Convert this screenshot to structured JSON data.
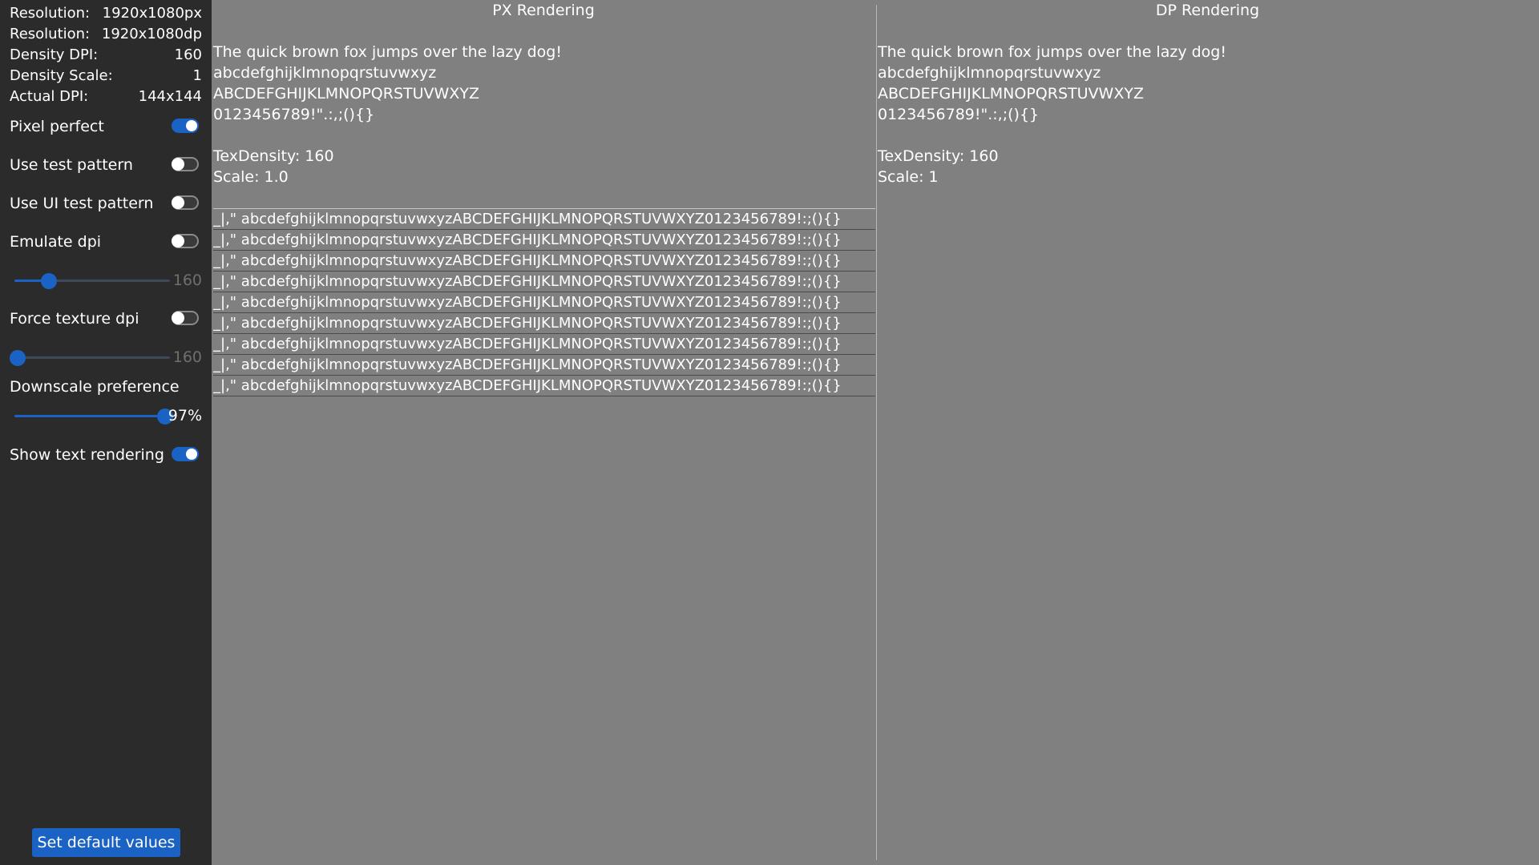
{
  "sidebar": {
    "info": [
      {
        "label": "Resolution:",
        "value": "1920x1080px"
      },
      {
        "label": "Resolution:",
        "value": "1920x1080dp"
      },
      {
        "label": "Density DPI:",
        "value": "160"
      },
      {
        "label": "Density Scale:",
        "value": "1"
      },
      {
        "label": "Actual DPI:",
        "value": "144x144"
      }
    ],
    "toggles": {
      "pixel_perfect": {
        "label": "Pixel perfect",
        "on": true
      },
      "use_test_pattern": {
        "label": "Use test pattern",
        "on": false
      },
      "use_ui_test_pattern": {
        "label": "Use UI test pattern",
        "on": false
      },
      "emulate_dpi": {
        "label": "Emulate dpi",
        "on": false
      },
      "force_texture_dpi": {
        "label": "Force texture dpi",
        "on": false
      },
      "show_text_rendering": {
        "label": "Show text rendering",
        "on": true
      }
    },
    "sliders": {
      "emulate_dpi": {
        "value": "160",
        "fraction": 0.22,
        "enabled": false
      },
      "force_texture_dpi": {
        "value": "160",
        "fraction": 0.02,
        "enabled": false
      },
      "downscale_preference": {
        "label": "Downscale preference",
        "value": "97%",
        "fraction": 0.97,
        "enabled": true
      }
    },
    "default_button": "Set default values"
  },
  "px_panel": {
    "title": "PX Rendering",
    "lines": [
      "The quick brown fox jumps over the lazy dog!",
      "abcdefghijklmnopqrstuvwxyz",
      "ABCDEFGHIJKLMNOPQRSTUVWXYZ",
      "0123456789!\".:,;(){}"
    ],
    "tex_density": "TexDensity: 160",
    "scale": "Scale: 1.0",
    "sample_rows": [
      "_|,\" abcdefghijklmnopqrstuvwxyzABCDEFGHIJKLMNOPQRSTUVWXYZ0123456789!:;(){}",
      "_|,\" abcdefghijklmnopqrstuvwxyzABCDEFGHIJKLMNOPQRSTUVWXYZ0123456789!:;(){}",
      "_|,\" abcdefghijklmnopqrstuvwxyzABCDEFGHIJKLMNOPQRSTUVWXYZ0123456789!:;(){}",
      "_|,\" abcdefghijklmnopqrstuvwxyzABCDEFGHIJKLMNOPQRSTUVWXYZ0123456789!:;(){}",
      "_|,\" abcdefghijklmnopqrstuvwxyzABCDEFGHIJKLMNOPQRSTUVWXYZ0123456789!:;(){}",
      "_|,\" abcdefghijklmnopqrstuvwxyzABCDEFGHIJKLMNOPQRSTUVWXYZ0123456789!:;(){}",
      "_|,\" abcdefghijklmnopqrstuvwxyzABCDEFGHIJKLMNOPQRSTUVWXYZ0123456789!:;(){}",
      "_|,\" abcdefghijklmnopqrstuvwxyzABCDEFGHIJKLMNOPQRSTUVWXYZ0123456789!:;(){}",
      "_|,\" abcdefghijklmnopqrstuvwxyzABCDEFGHIJKLMNOPQRSTUVWXYZ0123456789!:;(){}"
    ]
  },
  "dp_panel": {
    "title": "DP Rendering",
    "lines": [
      "The quick brown fox jumps over the lazy dog!",
      "abcdefghijklmnopqrstuvwxyz",
      "ABCDEFGHIJKLMNOPQRSTUVWXYZ",
      "0123456789!\".:,;(){}"
    ],
    "tex_density": "TexDensity: 160",
    "scale": "Scale: 1"
  },
  "colors": {
    "background": "#808080",
    "sidebar": "#2b2b2b",
    "accent": "#1a62c4"
  }
}
